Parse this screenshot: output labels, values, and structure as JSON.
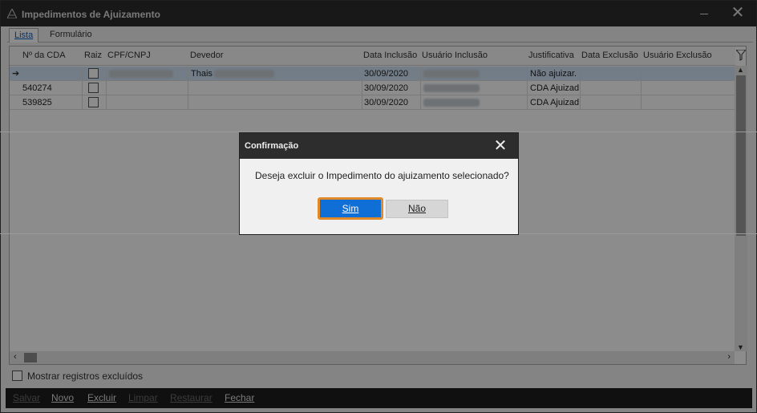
{
  "window": {
    "title": "Impedimentos de Ajuizamento"
  },
  "tabs": [
    {
      "label": "Lista",
      "active": true
    },
    {
      "label": "Formulário",
      "active": false
    }
  ],
  "grid": {
    "columns": [
      "Nº da CDA",
      "Raiz",
      "CPF/CNPJ",
      "Devedor",
      "Data Inclusão",
      "Usuário Inclusão",
      "Justificativa",
      "Data Exclusão",
      "Usuário Exclusão"
    ],
    "rows": [
      {
        "cda": "",
        "raiz": false,
        "cpf": "",
        "devedor": "Thais",
        "data_inclusao": "30/09/2020",
        "usuario_inclusao": "",
        "justificativa": "Não ajuizar.",
        "data_exclusao": "",
        "usuario_exclusao": "",
        "selected": true
      },
      {
        "cda": "540274",
        "raiz": false,
        "cpf": "",
        "devedor": "",
        "data_inclusao": "30/09/2020",
        "usuario_inclusao": "",
        "justificativa": "CDA Ajuizad",
        "data_exclusao": "",
        "usuario_exclusao": "",
        "selected": false
      },
      {
        "cda": "539825",
        "raiz": false,
        "cpf": "",
        "devedor": "",
        "data_inclusao": "30/09/2020",
        "usuario_inclusao": "",
        "justificativa": "CDA Ajuizad",
        "data_exclusao": "",
        "usuario_exclusao": "",
        "selected": false
      }
    ]
  },
  "show_deleted": {
    "label": "Mostrar registros excluídos",
    "checked": false
  },
  "toolbar": {
    "save": "Salvar",
    "new": "Novo",
    "delete": "Excluir",
    "clear": "Limpar",
    "restore": "Restaurar",
    "close": "Fechar"
  },
  "dialog": {
    "title": "Confirmação",
    "message": "Deseja excluir o Impedimento do ajuizamento selecionado?",
    "yes": "Sim",
    "no": "Não"
  },
  "colors": {
    "accent": "#0f6fd6",
    "focus_ring": "#e08a2a",
    "titlebar": "#2d2d2d"
  },
  "icons": [
    "app-icon",
    "minimize-icon",
    "close-icon",
    "filter-icon",
    "row-pointer-icon",
    "scroll-up-icon",
    "scroll-down-icon",
    "scroll-left-icon",
    "scroll-right-icon"
  ]
}
